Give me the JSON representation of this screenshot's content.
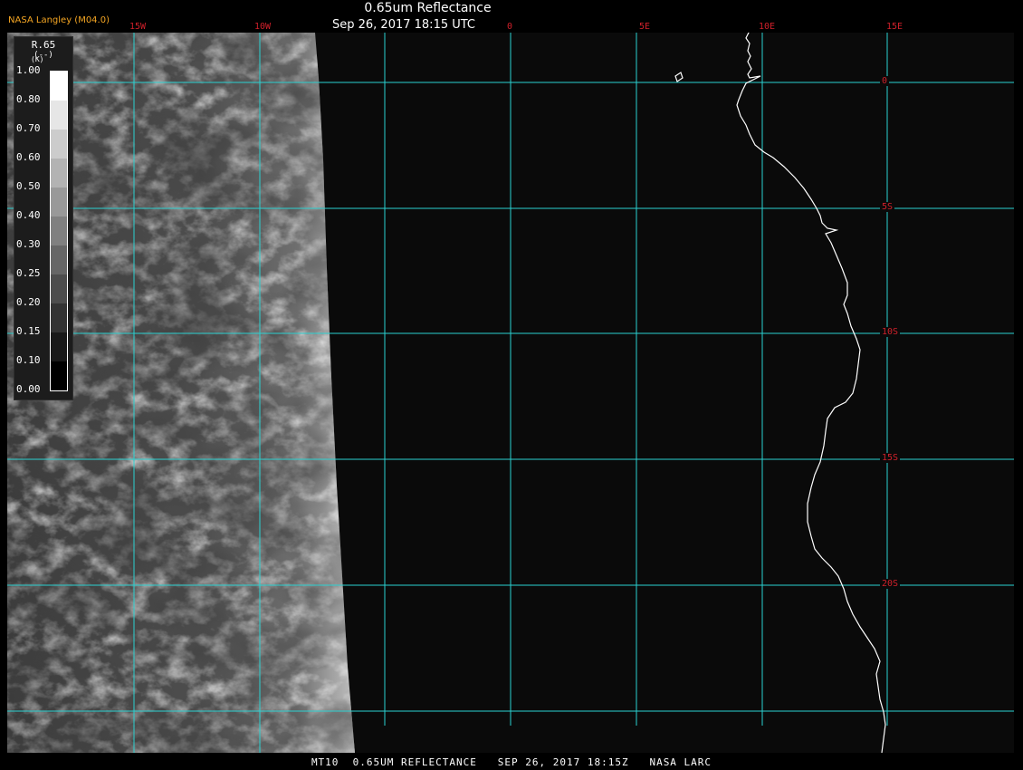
{
  "header": {
    "title": "0.65um Reflectance",
    "subtitle": "Sep 26, 2017 18:15 UTC",
    "source": "NASA Langley (M04.0)"
  },
  "map": {
    "grid_color": "#2bd1d1",
    "label_color": "#d0202a",
    "coast_color": "#ffffff",
    "lon_labels": [
      "15W",
      "10W",
      "0",
      "5E",
      "10E",
      "15E"
    ],
    "lat_labels": [
      "0",
      "5S",
      "10S",
      "15S",
      "20S"
    ]
  },
  "legend": {
    "title": "R.65",
    "units": "(--)",
    "stray_mark": "(K)",
    "ticks": [
      "1.00",
      "0.80",
      "0.70",
      "0.60",
      "0.50",
      "0.40",
      "0.30",
      "0.25",
      "0.20",
      "0.15",
      "0.10",
      "0.00"
    ]
  },
  "footer": {
    "text": "MT10  0.65UM REFLECTANCE   SEP 26, 2017 18:15Z   NASA LARC"
  }
}
